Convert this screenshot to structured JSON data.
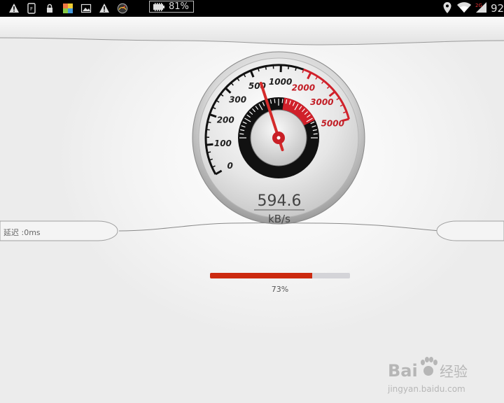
{
  "status_bar": {
    "battery_percent_label": "81%",
    "clock": "92",
    "icons": [
      "warning-icon",
      "sim-icon",
      "lock-icon",
      "app-icon",
      "image-icon",
      "warning-icon",
      "gauge-icon",
      "location-icon",
      "wifi-icon",
      "signal-icon"
    ]
  },
  "speedometer": {
    "speed_value": "594.6",
    "unit": "kB/s",
    "needle_value": 594.6,
    "scale_labels": [
      "0",
      "100",
      "200",
      "300",
      "500",
      "1000",
      "2000",
      "3000",
      "5000"
    ]
  },
  "latency_label": "延迟 :0ms",
  "progress": {
    "value": 0.73,
    "label": "73%"
  },
  "watermark": {
    "brand": "Bai",
    "subtitle": "经验",
    "url": "jingyan.baidu.com"
  },
  "colors": {
    "accent_red": "#cc2a10",
    "progress_track": "#d4d4d8",
    "background": "#f4f4f4"
  }
}
